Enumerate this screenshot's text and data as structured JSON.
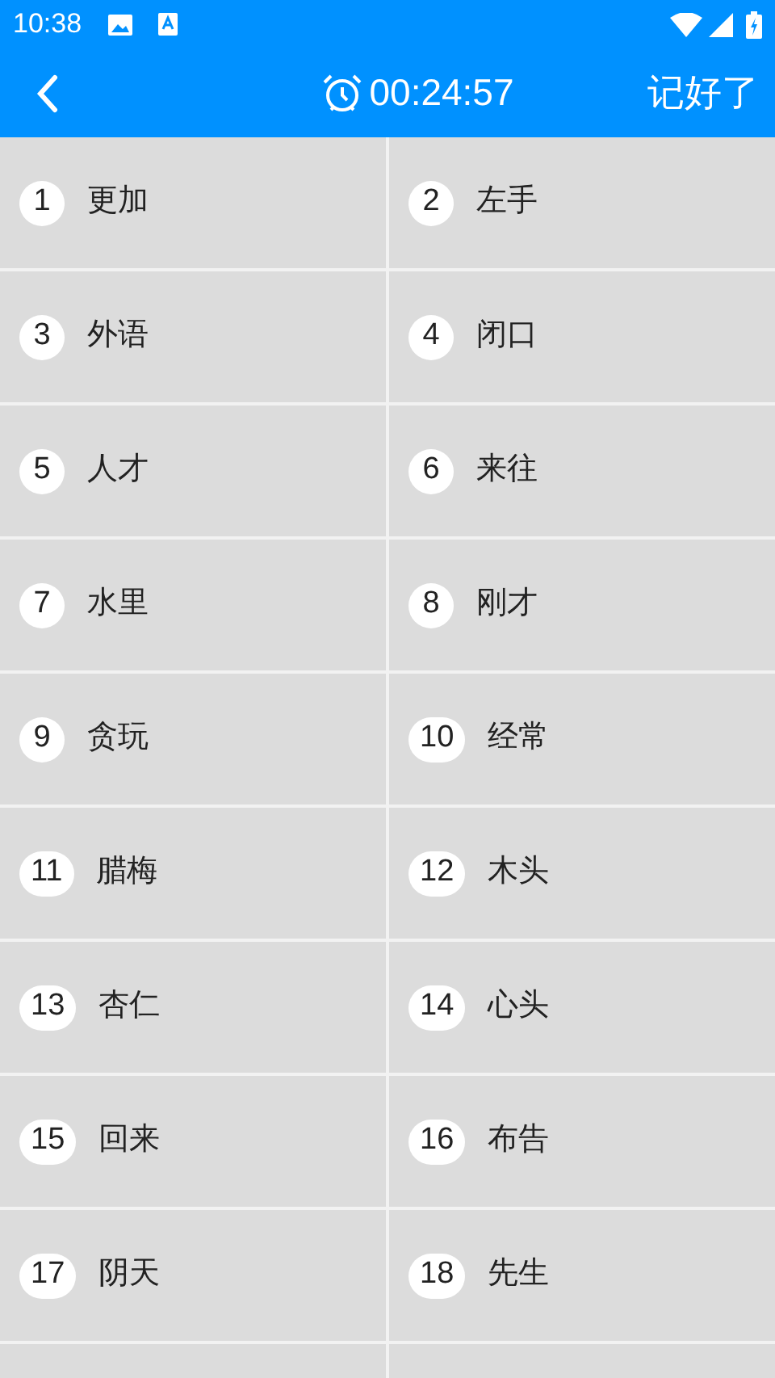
{
  "status_bar": {
    "time": "10:38"
  },
  "header": {
    "timer": "00:24:57",
    "action": "记好了"
  },
  "words": [
    {
      "number": "1",
      "word": "更加"
    },
    {
      "number": "2",
      "word": "左手"
    },
    {
      "number": "3",
      "word": "外语"
    },
    {
      "number": "4",
      "word": "闭口"
    },
    {
      "number": "5",
      "word": "人才"
    },
    {
      "number": "6",
      "word": "来往"
    },
    {
      "number": "7",
      "word": "水里"
    },
    {
      "number": "8",
      "word": "刚才"
    },
    {
      "number": "9",
      "word": "贪玩"
    },
    {
      "number": "10",
      "word": "经常"
    },
    {
      "number": "11",
      "word": "腊梅"
    },
    {
      "number": "12",
      "word": "木头"
    },
    {
      "number": "13",
      "word": "杏仁"
    },
    {
      "number": "14",
      "word": "心头"
    },
    {
      "number": "15",
      "word": "回来"
    },
    {
      "number": "16",
      "word": "布告"
    },
    {
      "number": "17",
      "word": "阴天"
    },
    {
      "number": "18",
      "word": "先生"
    }
  ]
}
